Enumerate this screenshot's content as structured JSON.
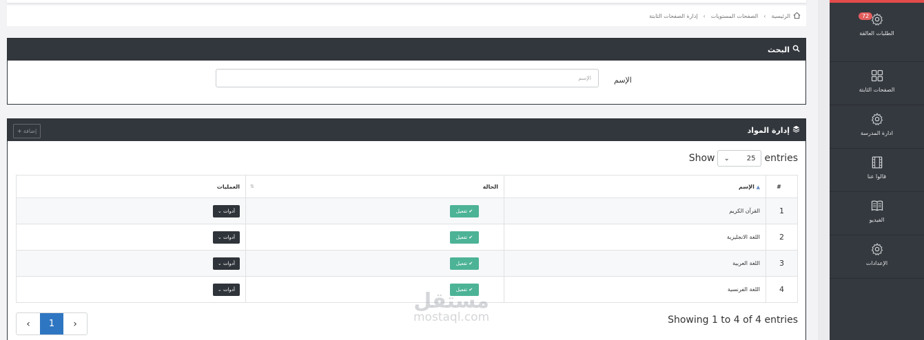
{
  "breadcrumb": {
    "home": "الرئيسية",
    "levels": "الصفحات المستويات",
    "current": "إدارة الصفحات الثابتة"
  },
  "search": {
    "title": "البحث",
    "name_label": "الإسم",
    "name_placeholder": "الإسم"
  },
  "manage": {
    "title": "إدارة المواد",
    "add_label": "إضافة",
    "show_prefix": "Show",
    "show_value": "25",
    "show_suffix": "entries",
    "columns": {
      "num": "#",
      "name": "الإسم",
      "status": "الحالة",
      "ops": "العمليات"
    },
    "rows": [
      {
        "num": "1",
        "name": "القرآن الكريم",
        "status": "تفعيل",
        "tools": "أدوات"
      },
      {
        "num": "2",
        "name": "اللغة الانجليزية",
        "status": "تفعيل",
        "tools": "أدوات"
      },
      {
        "num": "3",
        "name": "اللغة العربية",
        "status": "تفعيل",
        "tools": "أدوات"
      },
      {
        "num": "4",
        "name": "اللغة الفرنسية",
        "status": "تفعيل",
        "tools": "أدوات"
      }
    ],
    "pager": {
      "prev": "‹",
      "page": "1",
      "next": "›"
    },
    "showing": "Showing 1 to 4 of 4 entries"
  },
  "sidebar": {
    "items": [
      {
        "label": "الطلبات العالقة",
        "icon": "gear-icon",
        "badge": "72"
      },
      {
        "label": "الصفحات الثابتة",
        "icon": "grid-icon"
      },
      {
        "label": "ادارة المدرسة",
        "icon": "gear-icon"
      },
      {
        "label": "قالوا عنا",
        "icon": "film-icon"
      },
      {
        "label": "الفيديو",
        "icon": "book-icon"
      },
      {
        "label": "الإعدادات",
        "icon": "gear-icon"
      }
    ]
  },
  "watermark": {
    "arabic": "مستقل",
    "latin": "mostaql.com"
  },
  "colors": {
    "header": "#32373d",
    "status": "#4db396",
    "pager_active": "#2f76c2",
    "accent": "#e34b4b"
  }
}
